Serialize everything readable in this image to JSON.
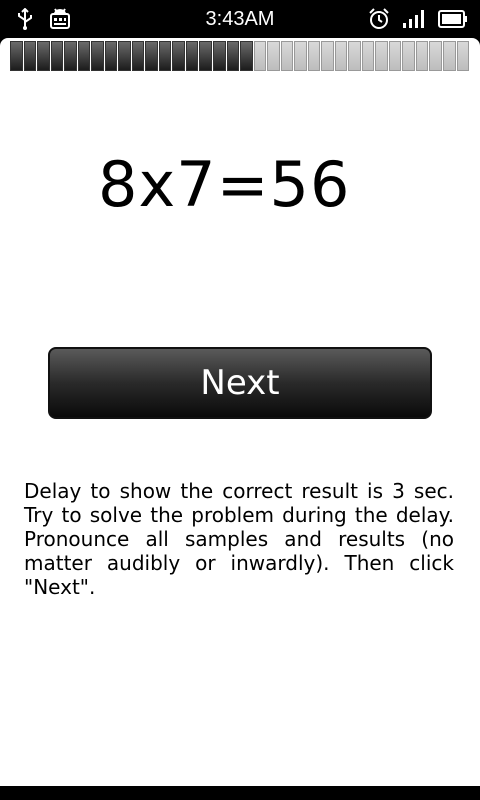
{
  "status_bar": {
    "time": "3:43AM",
    "icons_left": [
      "usb-icon",
      "android-debug-icon"
    ],
    "icons_right": [
      "alarm-clock-icon",
      "signal-strength-icon",
      "battery-icon"
    ]
  },
  "progress": {
    "total_segments": 34,
    "completed_segments": 18
  },
  "problem": {
    "text": "8x7=56"
  },
  "next_button": {
    "label": "Next"
  },
  "hint": {
    "text": "Delay to show the correct result is 3 sec. Try to solve the problem during the delay. Pronounce all samples and results (no matter audibly or inwardly). Then click \"Next\"."
  },
  "colors": {
    "background": "#ffffff",
    "statusbar": "#000000",
    "button_top": "#5a5a5a",
    "button_bottom": "#0a0a0a"
  }
}
